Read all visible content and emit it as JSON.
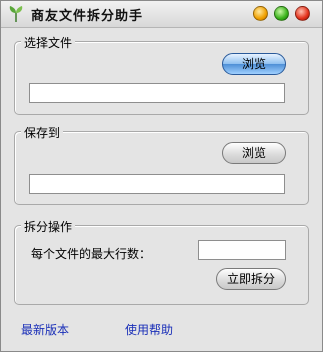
{
  "window": {
    "title": "商友文件拆分助手"
  },
  "select_file": {
    "legend": "选择文件",
    "browse_label": "浏览",
    "path_value": ""
  },
  "save_to": {
    "legend": "保存到",
    "browse_label": "浏览",
    "path_value": ""
  },
  "split": {
    "legend": "拆分操作",
    "max_rows_label": "每个文件的最大行数：",
    "max_rows_value": "",
    "split_button_label": "立即拆分"
  },
  "footer": {
    "latest_version": "最新版本",
    "help": "使用帮助"
  },
  "colors": {
    "link": "#1a2fb8",
    "window_bg": "#e4e4e4"
  }
}
